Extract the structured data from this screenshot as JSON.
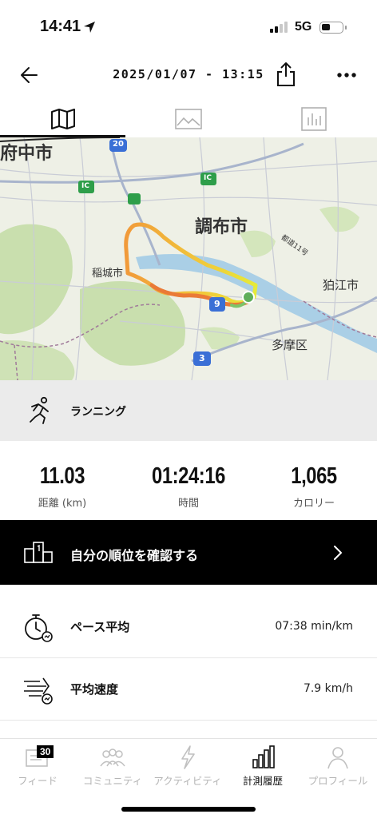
{
  "status": {
    "time": "14:41",
    "network": "5G"
  },
  "header": {
    "title": "2025/01/07 - 13:15"
  },
  "map": {
    "labels": {
      "fuchu": "府中市",
      "chofu": "調布市",
      "inagi": "稲城市",
      "komae": "狛江市",
      "tama": "多摩区",
      "road11": "都道11号",
      "route20": "20",
      "route9": "9",
      "route3": "3",
      "ic1": "IC",
      "ic2": "IC"
    }
  },
  "activity": {
    "label": "ランニング"
  },
  "stats": {
    "distance": {
      "value": "11.03",
      "label": "距離 (km)"
    },
    "time": {
      "value": "01:24:16",
      "label": "時間"
    },
    "calories": {
      "value": "1,065",
      "label": "カロリー"
    }
  },
  "rank": {
    "label": "自分の順位を確認する"
  },
  "metrics": {
    "pace": {
      "label": "ペース平均",
      "value": "07:38 min/km"
    },
    "speed": {
      "label": "平均速度",
      "value": "7.9 km/h"
    }
  },
  "tabbar": {
    "feed": {
      "label": "フィード",
      "badge": "30"
    },
    "community": {
      "label": "コミュニティ"
    },
    "activity": {
      "label": "アクティビティ"
    },
    "history": {
      "label": "計測履歴"
    },
    "profile": {
      "label": "プロフィール"
    }
  },
  "colors": {
    "route_start": "#f2a13a",
    "route_end": "#e8e83a",
    "accent": "#000000"
  }
}
